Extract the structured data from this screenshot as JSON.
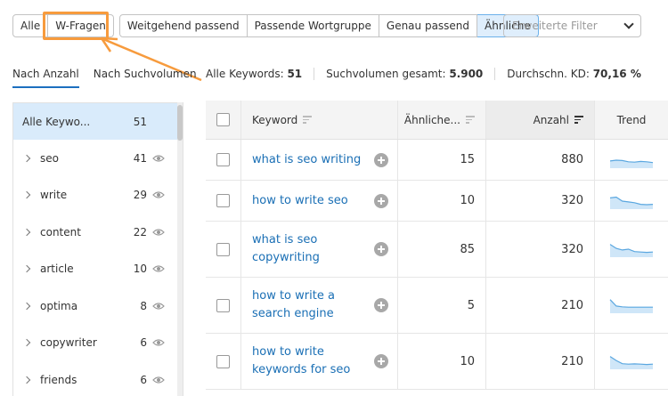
{
  "filters": {
    "group1": [
      "Alle",
      "W-Fragen"
    ],
    "group2": [
      "Weitgehend passend",
      "Passende Wortgruppe",
      "Genau passend",
      "Ähnliche"
    ],
    "advanced_placeholder": "Erweiterte Filter"
  },
  "tabs": [
    "Nach Anzahl",
    "Nach Suchvolumen"
  ],
  "stats": {
    "all_keywords_label": "Alle Keywords:",
    "all_keywords_value": "51",
    "volume_label": "Suchvolumen gesamt:",
    "volume_value": "5.900",
    "kd_label": "Durchschn. KD:",
    "kd_value": "70,16 %"
  },
  "sidebar": {
    "items": [
      {
        "label": "Alle Keywo...",
        "count": "51"
      },
      {
        "label": "seo",
        "count": "41"
      },
      {
        "label": "write",
        "count": "29"
      },
      {
        "label": "content",
        "count": "22"
      },
      {
        "label": "article",
        "count": "10"
      },
      {
        "label": "optima",
        "count": "8"
      },
      {
        "label": "copywriter",
        "count": "6"
      },
      {
        "label": "friends",
        "count": "6"
      }
    ]
  },
  "table": {
    "headers": {
      "keyword": "Keyword",
      "similar": "Ähnliche...",
      "count": "Anzahl",
      "trend": "Trend"
    },
    "rows": [
      {
        "keyword": "what is seo writing",
        "similar": "15",
        "count": "880",
        "trend": [
          0.55,
          0.5,
          0.52,
          0.6,
          0.62,
          0.58,
          0.6,
          0.65
        ]
      },
      {
        "keyword": "how to write seo",
        "similar": "10",
        "count": "320",
        "trend": [
          0.3,
          0.25,
          0.5,
          0.55,
          0.6,
          0.7,
          0.72,
          0.7
        ]
      },
      {
        "keyword": "what is seo copywriting",
        "similar": "85",
        "count": "320",
        "trend": [
          0.2,
          0.45,
          0.55,
          0.5,
          0.65,
          0.68,
          0.7,
          0.68
        ]
      },
      {
        "keyword": "how to write a search engine",
        "similar": "5",
        "count": "210",
        "trend": [
          0.15,
          0.55,
          0.6,
          0.62,
          0.62,
          0.62,
          0.62,
          0.62
        ]
      },
      {
        "keyword": "how to write keywords for seo",
        "similar": "10",
        "count": "210",
        "trend": [
          0.2,
          0.45,
          0.65,
          0.68,
          0.66,
          0.68,
          0.7,
          0.68
        ]
      }
    ]
  },
  "colors": {
    "accent": "#1c6fbf",
    "highlight": "#f79b3d",
    "selected_bg": "#d9ebfb",
    "sparkline_fill": "#cfe6f8",
    "sparkline_line": "#5aa7e0"
  }
}
